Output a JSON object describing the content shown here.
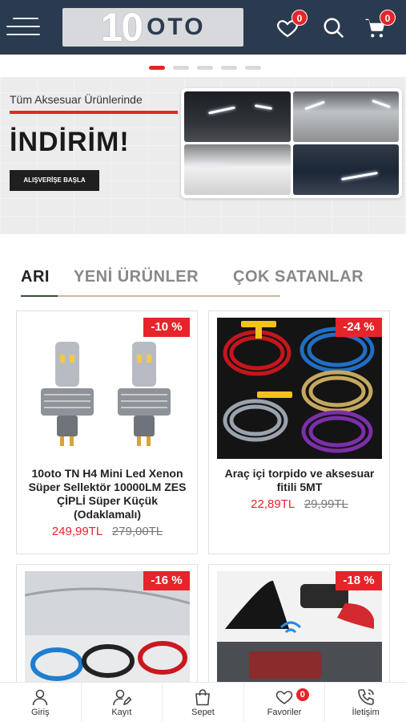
{
  "header": {
    "logo_number": "10",
    "logo_word": "OTO",
    "favorites_count": "0",
    "cart_count": "0",
    "icons": [
      "menu-icon",
      "heart-icon",
      "search-icon",
      "cart-icon"
    ]
  },
  "slider": {
    "pages": 5,
    "active_page": 1
  },
  "banner": {
    "subtitle": "Tüm Aksesuar Ürünlerinde",
    "title": "İNDİRİM!",
    "button_label": "ALIŞVERİŞE BAŞLA"
  },
  "tabs": [
    {
      "label": "ARI",
      "active": true
    },
    {
      "label": "YENİ ÜRÜNLER",
      "active": false
    },
    {
      "label": "ÇOK SATANLAR",
      "active": false
    }
  ],
  "products": [
    {
      "discount": "-10 %",
      "name": "10oto TN H4 Mini Led Xenon Süper Sellektör 10000LM ZES ÇİPLİ Süper Küçük (Odaklamalı)",
      "price": "249,99TL",
      "old_price": "279,00TL"
    },
    {
      "discount": "-24 %",
      "name": "Araç içi torpido ve aksesuar fitili 5MT",
      "price": "22,89TL",
      "old_price": "29,99TL"
    },
    {
      "discount": "-16 %",
      "name": "",
      "price": "",
      "old_price": ""
    },
    {
      "discount": "-18 %",
      "name": "",
      "price": "",
      "old_price": ""
    }
  ],
  "bottom_nav": [
    {
      "label": "Giriş",
      "icon": "user-icon"
    },
    {
      "label": "Kayıt",
      "icon": "user-edit-icon"
    },
    {
      "label": "Sepet",
      "icon": "bag-icon"
    },
    {
      "label": "Favoriler",
      "icon": "heart-icon",
      "badge": "0"
    },
    {
      "label": "İletişim",
      "icon": "phone-icon"
    }
  ],
  "colors": {
    "header_bg": "#2b3b4f",
    "accent": "#e5252a"
  }
}
